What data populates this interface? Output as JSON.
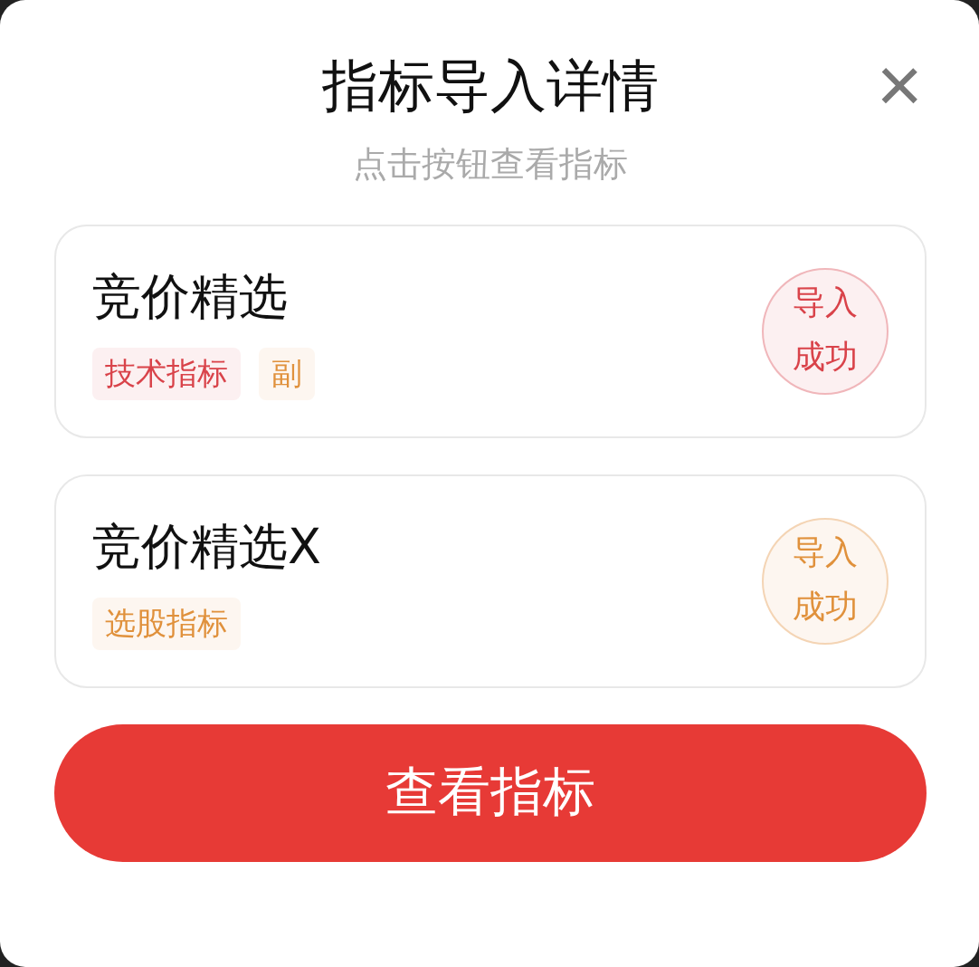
{
  "dialog": {
    "title": "指标导入详情",
    "subtitle": "点击按钮查看指标",
    "close": "×"
  },
  "items": [
    {
      "name": "竞价精选",
      "tags": [
        {
          "label": "技术指标",
          "color": "#d9434a"
        },
        {
          "label": "副",
          "color": "#e0913c"
        }
      ],
      "status": "导入成功",
      "color": "#d9434a"
    },
    {
      "name": "竞价精选X",
      "tags": [
        {
          "label": "选股指标",
          "color": "#e0913c"
        }
      ],
      "status": "导入成功",
      "color": "#e0913c"
    }
  ],
  "button": "查看指标"
}
